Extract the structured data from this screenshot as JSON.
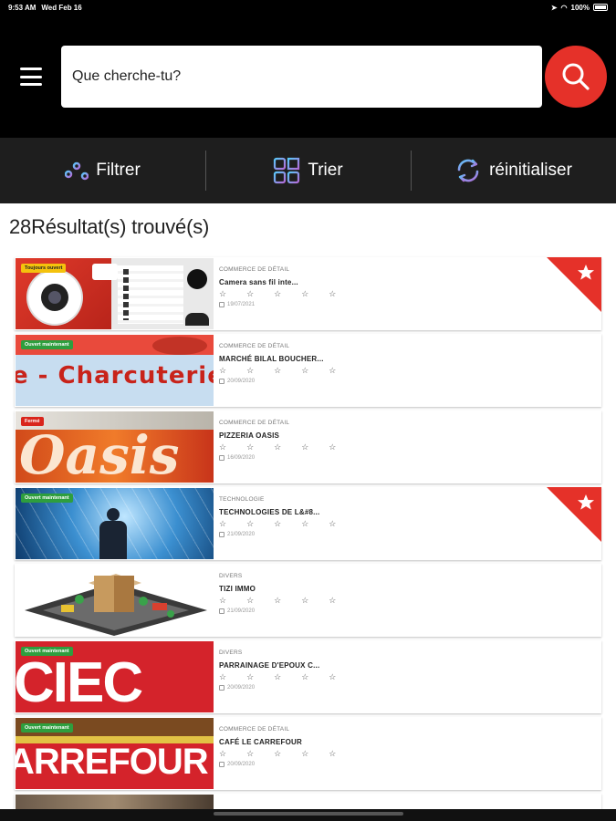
{
  "status_bar": {
    "time": "9:53 AM",
    "date": "Wed Feb 16",
    "battery": "100%"
  },
  "search": {
    "placeholder": "Que cherche-tu?"
  },
  "toolbar": {
    "filter_label": "Filtrer",
    "sort_label": "Trier",
    "reset_label": "réinitialiser"
  },
  "results": {
    "title": "28Résultat(s) trouvé(s)"
  },
  "stars_text": "☆☆☆☆☆",
  "colors": {
    "accent": "#e53129",
    "badge_green": "#2e9e3e",
    "badge_red": "#d9251c",
    "badge_yellow": "#f4c20d"
  },
  "listings": [
    {
      "badge": "Toujours ouvert",
      "badge_color": "yellow",
      "category": "COMMERCE DE DÉTAIL",
      "name": "Camera sans fil inte...",
      "date": "19/07/2021",
      "favorite": true
    },
    {
      "badge": "Ouvert maintenant",
      "badge_color": "green",
      "category": "COMMERCE DE DÉTAIL",
      "name": "MARCHÉ BILAL BOUCHER...",
      "date": "20/09/2020",
      "favorite": false,
      "thumb_text": "e - Charcuterie"
    },
    {
      "badge": "Fermé",
      "badge_color": "red",
      "category": "COMMERCE DE DÉTAIL",
      "name": "PIZZERIA OASIS",
      "date": "16/09/2020",
      "favorite": false,
      "thumb_text": "Oasis"
    },
    {
      "badge": "Ouvert maintenant",
      "badge_color": "green",
      "category": "TECHNOLOGIE",
      "name": "TECHNOLOGIES DE L&#8...",
      "date": "21/09/2020",
      "favorite": true
    },
    {
      "badge": "",
      "badge_color": "",
      "category": "DIVERS",
      "name": "TIZI IMMO",
      "date": "21/09/2020",
      "favorite": false
    },
    {
      "badge": "Ouvert maintenant",
      "badge_color": "green",
      "category": "DIVERS",
      "name": "PARRAINAGE D'EPOUX C...",
      "date": "20/09/2020",
      "favorite": false,
      "thumb_text": "CIEC"
    },
    {
      "badge": "Ouvert maintenant",
      "badge_color": "green",
      "category": "COMMERCE DE DÉTAIL",
      "name": "CAFÉ LE CARREFOUR",
      "date": "20/09/2020",
      "favorite": false,
      "thumb_text": "ARREFOUR"
    }
  ]
}
